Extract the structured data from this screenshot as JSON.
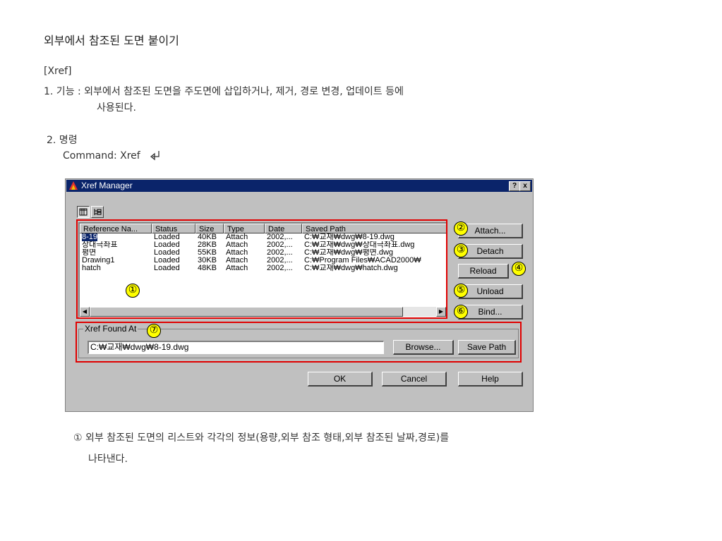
{
  "doc": {
    "title": "외부에서 참조된 도면 붙이기",
    "command_tag": "[Xref]",
    "line1": "1. 기능 : 외부에서 참조된 도면을 주도면에 삽입하거나, 제거, 경로 변경, 업데이트 등에",
    "line1b": "사용된다.",
    "line2": "2. 명령",
    "command_line": "Command: Xref",
    "note_line1": "① 외부 참조된 도면의 리스트와 각각의 정보(용량,외부 참조 형태,외부 참조된 날짜,경로)를",
    "note_line2": "나타낸다."
  },
  "dialog": {
    "title": "Xref Manager",
    "help_btn": "?",
    "close_btn": "x",
    "columns": [
      "Reference Na...",
      "Status",
      "Size",
      "Type",
      "Date",
      "Saved Path"
    ],
    "rows": [
      [
        "8-19",
        "Loaded",
        "40KB",
        "Attach",
        "2002,...",
        "C:₩교재₩dwg₩8-19.dwg"
      ],
      [
        "상대극좌표",
        "Loaded",
        "28KB",
        "Attach",
        "2002,...",
        "C:₩교재₩dwg₩상대극좌표.dwg"
      ],
      [
        "평면",
        "Loaded",
        "55KB",
        "Attach",
        "2002,...",
        "C:₩교재₩dwg₩평면.dwg"
      ],
      [
        "Drawing1",
        "Loaded",
        "30KB",
        "Attach",
        "2002,...",
        "C:₩Program Files₩ACAD2000₩"
      ],
      [
        "hatch",
        "Loaded",
        "48KB",
        "Attach",
        "2002,...",
        "C:₩교재₩dwg₩hatch.dwg"
      ]
    ],
    "buttons": {
      "attach": "Attach...",
      "detach": "Detach",
      "reload": "Reload",
      "unload": "Unload",
      "bind": "Bind...",
      "browse": "Browse...",
      "save_path": "Save Path",
      "ok": "OK",
      "cancel": "Cancel",
      "help": "Help"
    },
    "found_at_label": "Xref Found At",
    "found_at_value": "C:₩교재₩dwg₩8-19.dwg",
    "callouts": [
      "①",
      "②",
      "③",
      "④",
      "⑤",
      "⑥",
      "⑦"
    ]
  },
  "colors": {
    "titlebar": "#0a246a",
    "dialog_face": "#c0c0c0",
    "highlight_box": "#e00000",
    "callout_fill": "#ffff00"
  }
}
